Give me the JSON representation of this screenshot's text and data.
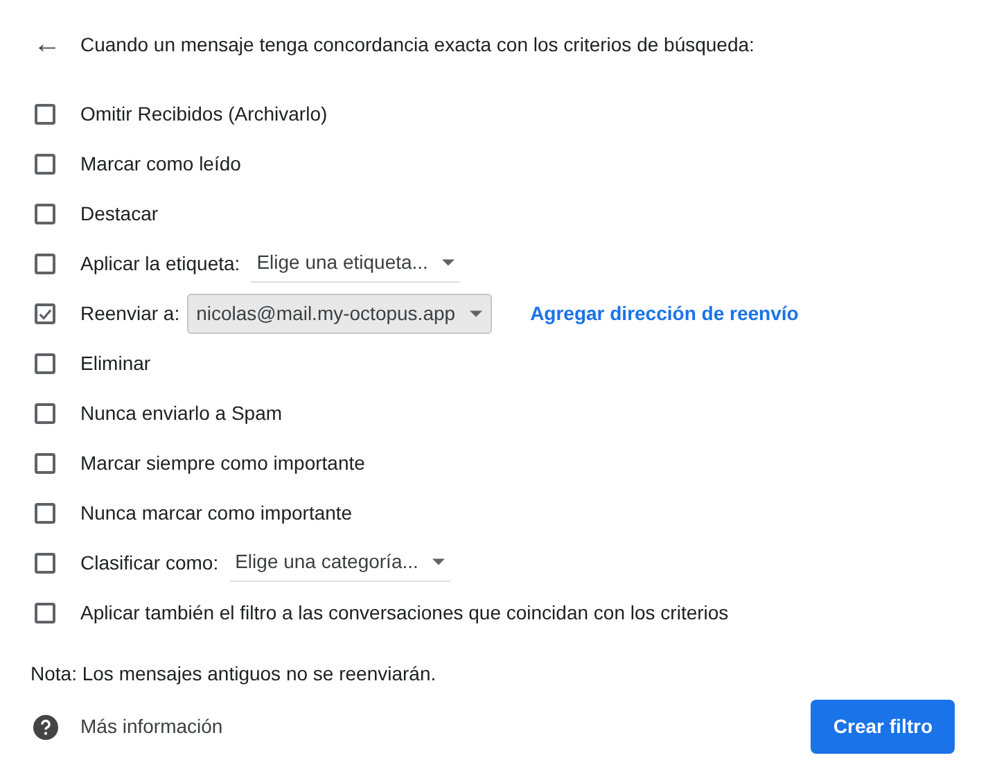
{
  "header": {
    "back_icon": "←",
    "title": "Cuando un mensaje tenga concordancia exacta con los criterios de búsqueda:"
  },
  "actions": [
    {
      "kind": "plain",
      "label": "Omitir Recibidos (Archivarlo)",
      "checked": false
    },
    {
      "kind": "plain",
      "label": "Marcar como leído",
      "checked": false
    },
    {
      "kind": "plain",
      "label": "Destacar",
      "checked": false
    },
    {
      "kind": "select",
      "label": "Aplicar la etiqueta:",
      "value": "Elige una etiqueta...",
      "checked": false
    },
    {
      "kind": "forward",
      "label": "Reenviar a:",
      "value": "nicolas@mail.my-octopus.app",
      "link": "Agregar dirección de reenvío",
      "checked": true
    },
    {
      "kind": "plain",
      "label": "Eliminar",
      "checked": false
    },
    {
      "kind": "plain",
      "label": "Nunca enviarlo a Spam",
      "checked": false
    },
    {
      "kind": "plain",
      "label": "Marcar siempre como importante",
      "checked": false
    },
    {
      "kind": "plain",
      "label": "Nunca marcar como importante",
      "checked": false
    },
    {
      "kind": "select",
      "label": "Clasificar como:",
      "value": "Elige una categoría...",
      "checked": false
    },
    {
      "kind": "plain",
      "label": "Aplicar también el filtro a las conversaciones que coincidan con los criterios",
      "checked": false
    }
  ],
  "note": "Nota: Los mensajes antiguos no se reenviarán.",
  "footer": {
    "help_link": "Más información",
    "create_button": "Crear filtro"
  }
}
